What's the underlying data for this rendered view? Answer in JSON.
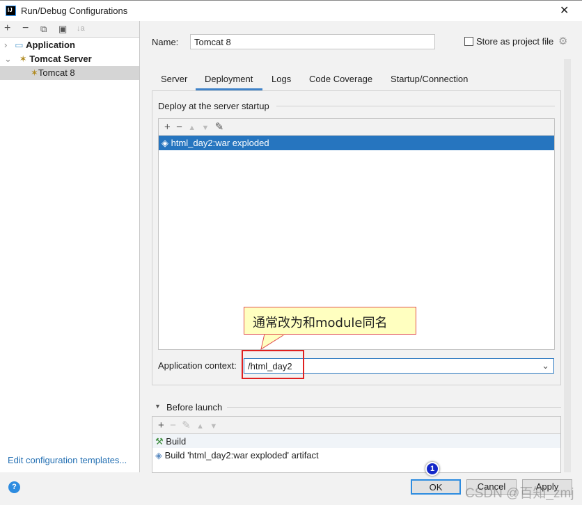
{
  "window": {
    "title": "Run/Debug Configurations",
    "logo": "IJ"
  },
  "sidebar": {
    "tools": [
      "+",
      "−",
      "⧉",
      "▣",
      "↓a"
    ],
    "items": [
      {
        "label": "Application",
        "expanded": false
      },
      {
        "label": "Tomcat Server",
        "expanded": true
      },
      {
        "label": "Tomcat 8",
        "selected": true
      }
    ],
    "templates_link": "Edit configuration templates..."
  },
  "form": {
    "name_label": "Name:",
    "name_value": "Tomcat 8",
    "store_label": "Store as project file",
    "store_checked": false
  },
  "tabs": [
    {
      "label": "Server"
    },
    {
      "label": "Deployment",
      "active": true
    },
    {
      "label": "Logs"
    },
    {
      "label": "Code Coverage"
    },
    {
      "label": "Startup/Connection"
    }
  ],
  "deployment": {
    "section": "Deploy at the server startup",
    "items": [
      "html_day2:war exploded"
    ],
    "context_label": "Application context:",
    "context_value": "/html_day2"
  },
  "callout": "通常改为和module同名",
  "before_launch": {
    "title": "Before launch",
    "items": [
      "Build",
      "Build 'html_day2:war exploded' artifact"
    ]
  },
  "footer": {
    "ok": "OK",
    "cancel": "Cancel",
    "apply": "Apply",
    "badge": "1",
    "help": "?"
  },
  "watermark": "CSDN @百知_zmj",
  "colors": {
    "accent": "#2675bf",
    "link": "#2470b3",
    "highlight": "#e02020"
  }
}
